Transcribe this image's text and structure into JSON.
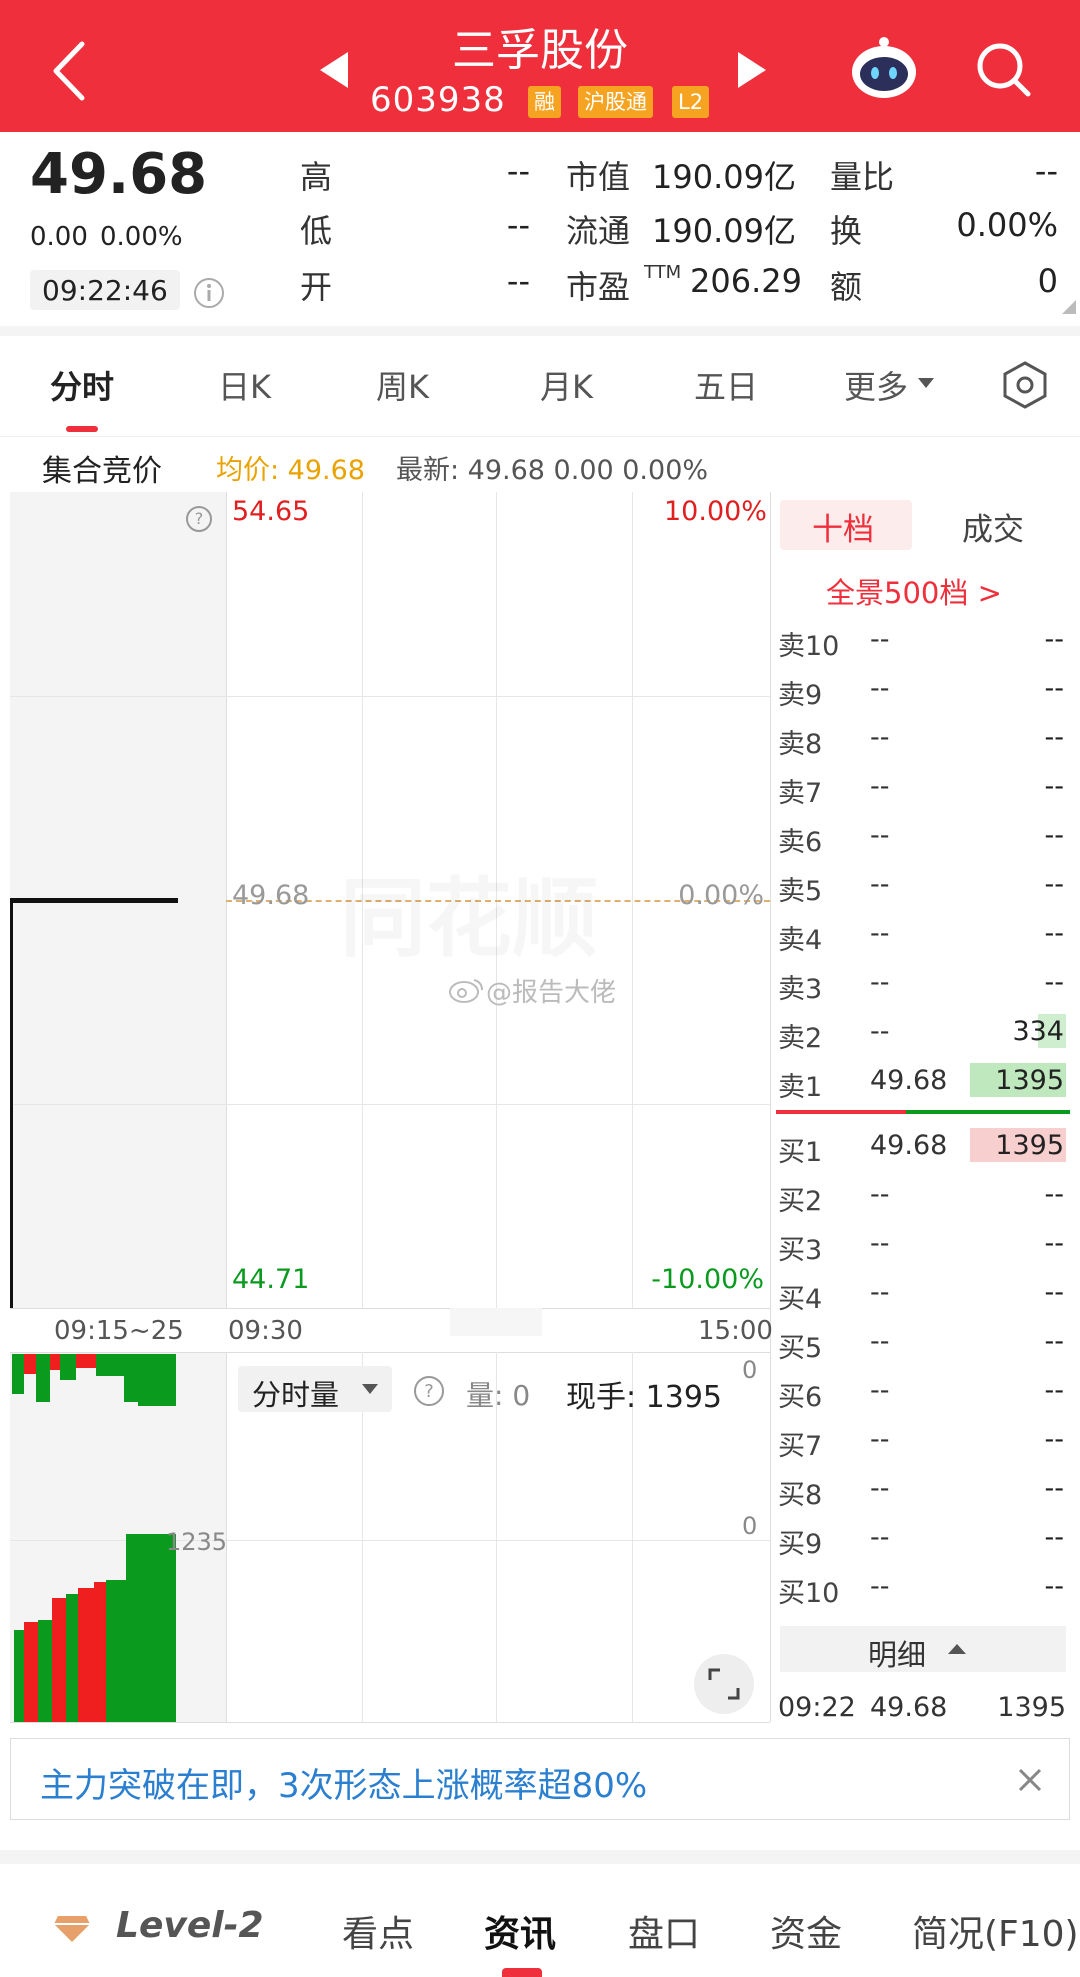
{
  "header": {
    "title": "三孚股份",
    "code": "603938",
    "tags": [
      "融",
      "沪股通",
      "L2"
    ]
  },
  "quote": {
    "price": "49.68",
    "change": "0.00",
    "change_pct": "0.00%",
    "time": "09:22:46",
    "high_label": "高",
    "high_value": "--",
    "low_label": "低",
    "low_value": "--",
    "open_label": "开",
    "open_value": "--",
    "mcap_label": "市值",
    "mcap_value": "190.09亿",
    "float_label": "流通",
    "float_value": "190.09亿",
    "pe_label": "市盈",
    "pe_sup": "TTM",
    "pe_value": "206.29",
    "vol_ratio_label": "量比",
    "vol_ratio_value": "--",
    "turnover_label": "换",
    "turnover_value": "0.00%",
    "amount_label": "额",
    "amount_value": "0"
  },
  "tabs": [
    "分时",
    "日K",
    "周K",
    "月K",
    "五日",
    "更多"
  ],
  "info_bar": {
    "label": "集合竞价",
    "avg": "均价: 49.68",
    "latest": "最新: 49.68  0.00  0.00%"
  },
  "chart": {
    "high_price": "54.65",
    "high_pct": "10.00%",
    "mid_price": "49.68",
    "mid_pct": "0.00%",
    "low_price": "44.71",
    "low_pct": "-10.00%",
    "time_start": "09:15~25",
    "time_open": "09:30",
    "time_close": "15:00",
    "watermark": "@报告大佬",
    "vol_label": "分时量",
    "vol_value": "量: 0",
    "hand_value": "现手: 1395",
    "vol_axis_top": "0",
    "vol_axis_mid": "0",
    "vol_axis_left": "1235"
  },
  "orderbook": {
    "tab_active": "十档",
    "tab_other": "成交",
    "panorama": "全景500档 >",
    "sells": [
      {
        "label": "卖10",
        "price": "--",
        "vol": "--"
      },
      {
        "label": "卖9",
        "price": "--",
        "vol": "--"
      },
      {
        "label": "卖8",
        "price": "--",
        "vol": "--"
      },
      {
        "label": "卖7",
        "price": "--",
        "vol": "--"
      },
      {
        "label": "卖6",
        "price": "--",
        "vol": "--"
      },
      {
        "label": "卖5",
        "price": "--",
        "vol": "--"
      },
      {
        "label": "卖4",
        "price": "--",
        "vol": "--"
      },
      {
        "label": "卖3",
        "price": "--",
        "vol": "--"
      },
      {
        "label": "卖2",
        "price": "--",
        "vol": "334"
      },
      {
        "label": "卖1",
        "price": "49.68",
        "vol": "1395"
      }
    ],
    "buys": [
      {
        "label": "买1",
        "price": "49.68",
        "vol": "1395"
      },
      {
        "label": "买2",
        "price": "--",
        "vol": "--"
      },
      {
        "label": "买3",
        "price": "--",
        "vol": "--"
      },
      {
        "label": "买4",
        "price": "--",
        "vol": "--"
      },
      {
        "label": "买5",
        "price": "--",
        "vol": "--"
      },
      {
        "label": "买6",
        "price": "--",
        "vol": "--"
      },
      {
        "label": "买7",
        "price": "--",
        "vol": "--"
      },
      {
        "label": "买8",
        "price": "--",
        "vol": "--"
      },
      {
        "label": "买9",
        "price": "--",
        "vol": "--"
      },
      {
        "label": "买10",
        "price": "--",
        "vol": "--"
      }
    ],
    "detail_label": "明细",
    "last_trade": {
      "time": "09:22",
      "price": "49.68",
      "vol": "1395"
    }
  },
  "banner": {
    "text": "主力突破在即，3次形态上涨概率超80%"
  },
  "bottom_nav": {
    "level2": "Level-2",
    "items": [
      "看点",
      "资讯",
      "盘口",
      "资金",
      "简况(F10)"
    ]
  },
  "colors": {
    "red": "#ef2f3b",
    "green": "#0a9a1e",
    "orange": "#f6a321",
    "gold": "#e9a200",
    "blue": "#2b7fd0"
  }
}
